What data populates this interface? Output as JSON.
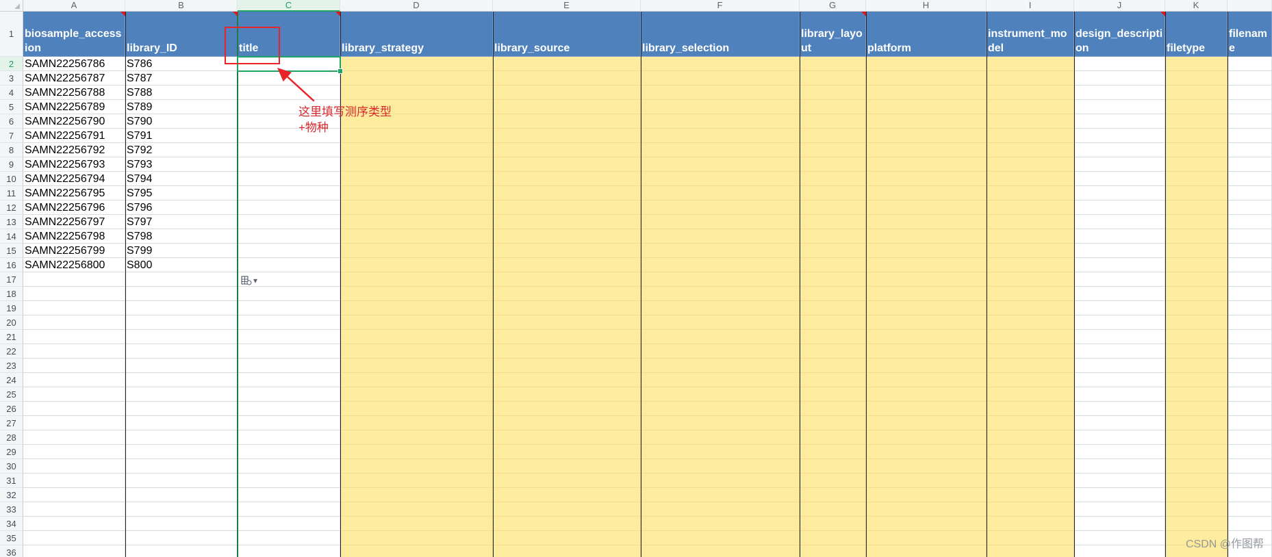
{
  "columns": [
    {
      "letter": "A",
      "header": "biosample_accession"
    },
    {
      "letter": "B",
      "header": "library_ID"
    },
    {
      "letter": "C",
      "header": "title"
    },
    {
      "letter": "D",
      "header": "library_strategy"
    },
    {
      "letter": "E",
      "header": "library_source"
    },
    {
      "letter": "F",
      "header": "library_selection"
    },
    {
      "letter": "G",
      "header": "library_layout"
    },
    {
      "letter": "H",
      "header": "platform"
    },
    {
      "letter": "I",
      "header": "instrument_model"
    },
    {
      "letter": "J",
      "header": "design_description"
    },
    {
      "letter": "K",
      "header": "filetype"
    },
    {
      "letter": "",
      "header": "filename"
    }
  ],
  "rows": [
    [
      "SAMN22256786",
      "S786"
    ],
    [
      "SAMN22256787",
      "S787"
    ],
    [
      "SAMN22256788",
      "S788"
    ],
    [
      "SAMN22256789",
      "S789"
    ],
    [
      "SAMN22256790",
      "S790"
    ],
    [
      "SAMN22256791",
      "S791"
    ],
    [
      "SAMN22256792",
      "S792"
    ],
    [
      "SAMN22256793",
      "S793"
    ],
    [
      "SAMN22256794",
      "S794"
    ],
    [
      "SAMN22256795",
      "S795"
    ],
    [
      "SAMN22256796",
      "S796"
    ],
    [
      "SAMN22256797",
      "S797"
    ],
    [
      "SAMN22256798",
      "S798"
    ],
    [
      "SAMN22256799",
      "S799"
    ],
    [
      "SAMN22256800",
      "S800"
    ]
  ],
  "row_count": 36,
  "yellow_columns": [
    "D",
    "E",
    "F",
    "G",
    "H",
    "I",
    "K"
  ],
  "selected_cell": "C2",
  "annotation": {
    "text": "这里填写测序类型+物种",
    "color": "#d9262c"
  },
  "paste_options_icon": "paste-options-icon",
  "watermark": "CSDN @作图帮",
  "colors": {
    "header_fill": "#4f81bd",
    "required_fill": "#fdec9e",
    "selection": "#1fa463",
    "annotation_red": "#e8232a"
  }
}
